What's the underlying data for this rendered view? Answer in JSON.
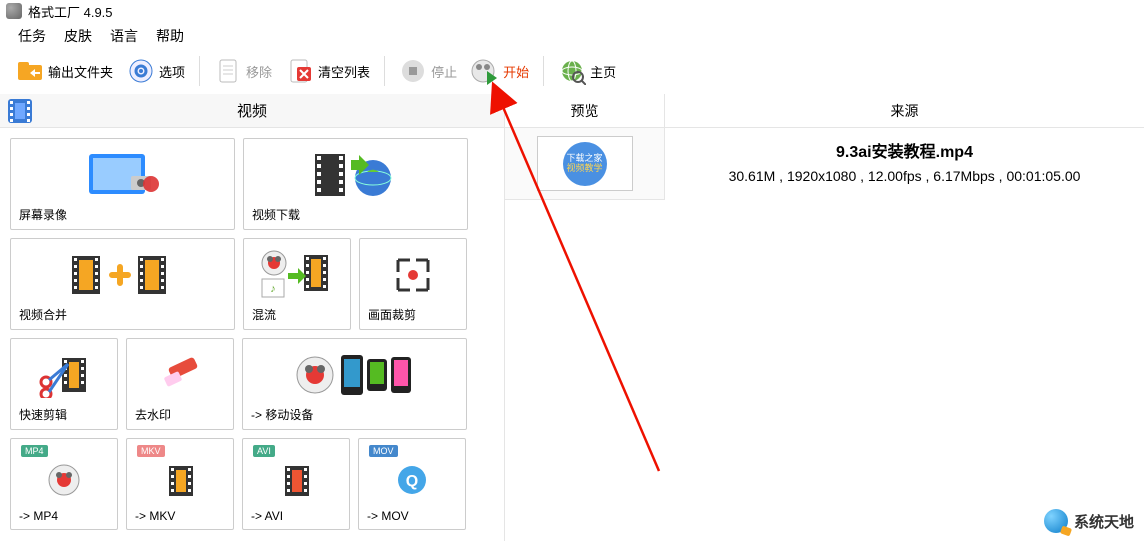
{
  "app": {
    "title": "格式工厂 4.9.5"
  },
  "menu": {
    "tasks": "任务",
    "skin": "皮肤",
    "language": "语言",
    "help": "帮助"
  },
  "toolbar": {
    "output_folder": "输出文件夹",
    "options": "选项",
    "remove": "移除",
    "clear_list": "清空列表",
    "stop": "停止",
    "start": "开始",
    "home": "主页"
  },
  "category": {
    "video": "视频"
  },
  "tiles": {
    "screen_record": "屏幕录像",
    "video_download": "视频下载",
    "video_merge": "视频合并",
    "mux": "混流",
    "crop": "画面裁剪",
    "quick_cut": "快速剪辑",
    "remove_wm": "去水印",
    "to_mobile": "-> 移动设备",
    "mp4": "-> MP4",
    "mp4_badge": "MP4",
    "mkv": "-> MKV",
    "mkv_badge": "MKV",
    "avi": "-> AVI",
    "avi_badge": "AVI",
    "mov": "-> MOV",
    "mov_badge": "MOV"
  },
  "headers": {
    "preview": "预览",
    "source": "来源"
  },
  "file": {
    "thumb_line1": "下载之家",
    "thumb_line2": "视频教学",
    "name": "9.3ai安装教程.mp4",
    "meta": "30.61M , 1920x1080 , 12.00fps , 6.17Mbps , 00:01:05.00"
  },
  "watermark": {
    "text": "系统天地"
  }
}
